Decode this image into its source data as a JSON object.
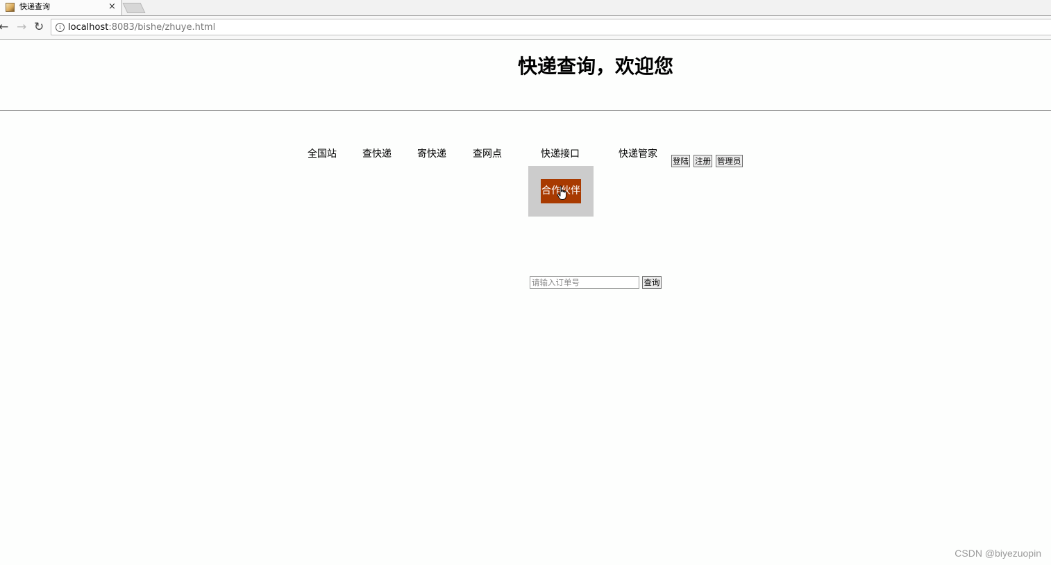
{
  "browser": {
    "tab_title": "快递查询",
    "tab_close": "×",
    "url_host": "localhost",
    "url_rest": ":8083/bishe/zhuye.html"
  },
  "page": {
    "title": "快递查询，欢迎您"
  },
  "nav": {
    "items": [
      "全国站",
      "查快递",
      "寄快递",
      "查网点",
      "快递接口",
      "快递管家"
    ],
    "dropdown_item": "合作伙伴"
  },
  "auth": {
    "login": "登陆",
    "register": "注册",
    "admin": "管理员"
  },
  "search": {
    "placeholder": "请输入订单号",
    "value": "",
    "button": "查询"
  },
  "colors": {
    "dropdown_bg": "#cccccc",
    "dropdown_item_bg": "#a83a00"
  },
  "watermark": "CSDN @biyezuopin"
}
